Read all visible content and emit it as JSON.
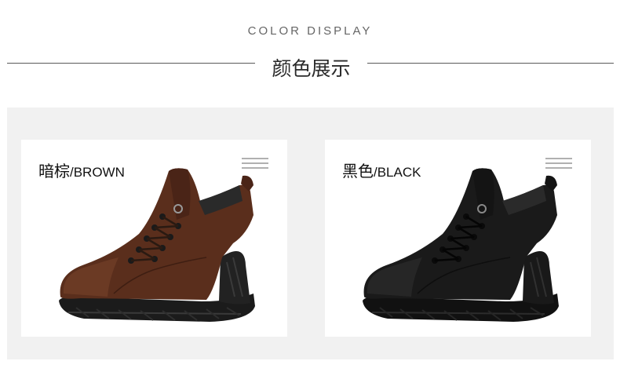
{
  "header": {
    "subtitle_en": "COLOR DISPLAY",
    "title_cn": "颜色展示"
  },
  "products": [
    {
      "label_cn": "暗棕",
      "label_en": "/BROWN",
      "color": "#5a2e1c",
      "icon": "boot-brown-icon"
    },
    {
      "label_cn": "黑色",
      "label_en": "/BLACK",
      "color": "#1a1a1a",
      "icon": "boot-black-icon"
    }
  ],
  "colors": {
    "panel_bg": "#f1f1f1",
    "divider": "#5a5a5a",
    "menu_lines": "#b0b0b0"
  }
}
